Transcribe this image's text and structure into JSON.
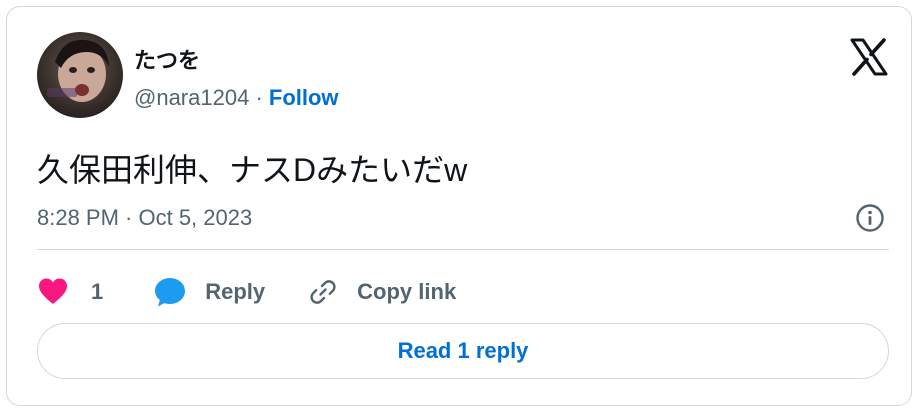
{
  "user": {
    "display_name": "たつを",
    "handle": "@nara1204",
    "separator": "·",
    "follow_label": "Follow",
    "avatar_icon": "user-avatar-photo"
  },
  "tweet": {
    "text": "久保田利伸、ナスDみたいだw",
    "timestamp": "8:28 PM · Oct 5, 2023"
  },
  "actions": {
    "like_count": "1",
    "reply_label": "Reply",
    "copy_link_label": "Copy link"
  },
  "footer": {
    "read_reply_label": "Read 1 reply"
  },
  "colors": {
    "like": "#f91880",
    "reply_icon": "#1d9bf0",
    "link": "#006fd6",
    "muted": "#536471",
    "border": "#cfd9de"
  },
  "icons": {
    "brand": "x-logo-icon",
    "info": "info-icon",
    "like": "heart-icon",
    "reply": "speech-bubble-icon",
    "copy": "link-icon"
  }
}
